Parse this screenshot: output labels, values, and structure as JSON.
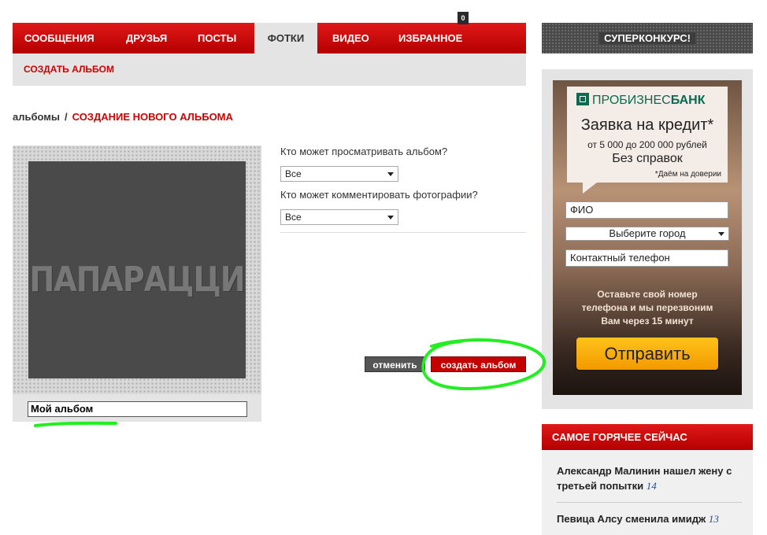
{
  "nav": {
    "items": [
      {
        "label": "СООБЩЕНИЯ",
        "active": false
      },
      {
        "label": "ДРУЗЬЯ",
        "active": false
      },
      {
        "label": "ПОСТЫ",
        "active": false
      },
      {
        "label": "ФОТКИ",
        "active": true
      },
      {
        "label": "ВИДЕО",
        "active": false
      },
      {
        "label": "ИЗБРАННОЕ",
        "active": false
      }
    ],
    "favorites_badge": "0",
    "sub_link": "СОЗДАТЬ АЛЬБОМ"
  },
  "breadcrumb": {
    "parent": "альбомы",
    "separator": "/",
    "current": "СОЗДАНИЕ НОВОГО АЛЬБОМА"
  },
  "album": {
    "cover_logo_text": "ПАПАРАЦЦИ",
    "name_value": "Мой альбом"
  },
  "privacy": {
    "view_question": "Кто может просматривать альбом?",
    "view_value": "Все",
    "comment_question": "Кто может комментировать фотографии?",
    "comment_value": "Все"
  },
  "actions": {
    "cancel_label": "отменить",
    "create_label": "создать альбом"
  },
  "sidebar": {
    "contest_label": "СУПЕРКОНКУРС!",
    "ad": {
      "bank_prefix": "ПРОБИЗНЕС",
      "bank_suffix": "БАНК",
      "title": "Заявка на кредит*",
      "range": "от 5 000 до 200 000 рублей",
      "no_docs": "Без справок",
      "note": "*Даём на доверии",
      "name_placeholder": "ФИО",
      "city_select": "Выберите город",
      "phone_placeholder": "Контактный телефон",
      "message_line1": "Оставьте свой номер",
      "message_line2": "телефона и мы перезвоним",
      "message_line3": "Вам через 15 минут",
      "submit_label": "Отправить"
    },
    "hot": {
      "heading": "САМОЕ ГОРЯЧЕЕ СЕЙЧАС",
      "items": [
        {
          "title": "Александр Малинин нашел жену с третьей попытки",
          "count": "14"
        },
        {
          "title": "Певица Алсу сменила имидж",
          "count": "13"
        }
      ]
    }
  },
  "colors": {
    "accent": "#c40000",
    "annotation": "#22ee22"
  }
}
